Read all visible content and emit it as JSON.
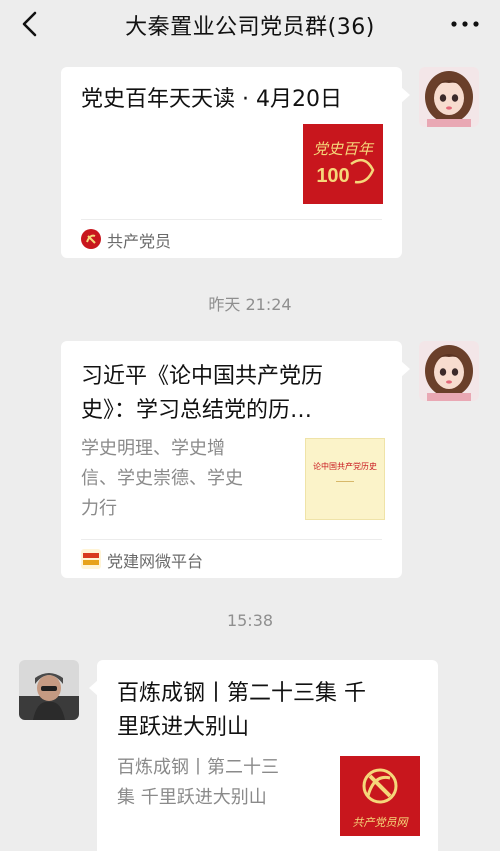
{
  "header": {
    "title": "大秦置业公司党员群(36)"
  },
  "messages": [
    {
      "title": "党史百年天天读 · 4月20日",
      "source": "共产党员"
    },
    {
      "title_line1": "习近平《论中国共产党历",
      "title_line2": "史》：学习总结党的历…",
      "desc_line1": "学史明理、学史增",
      "desc_line2": "信、学史崇德、学史",
      "desc_line3": "力行",
      "thumb_text": "论中国共产党历史",
      "source": "党建网微平台"
    },
    {
      "title_line1": "百炼成钢丨第二十三集 千",
      "title_line2": "里跃进大别山",
      "desc_line1": "百炼成钢丨第二十三",
      "desc_line2": "集 千里跃进大别山",
      "thumb_text": "共产党员网"
    }
  ],
  "timestamps": [
    "昨天 21:24",
    "15:38"
  ],
  "thumb1": {
    "big": "100",
    "script": "党史百年"
  },
  "colors": {
    "party_red": "#c8161d",
    "gold": "#f5d77a"
  }
}
